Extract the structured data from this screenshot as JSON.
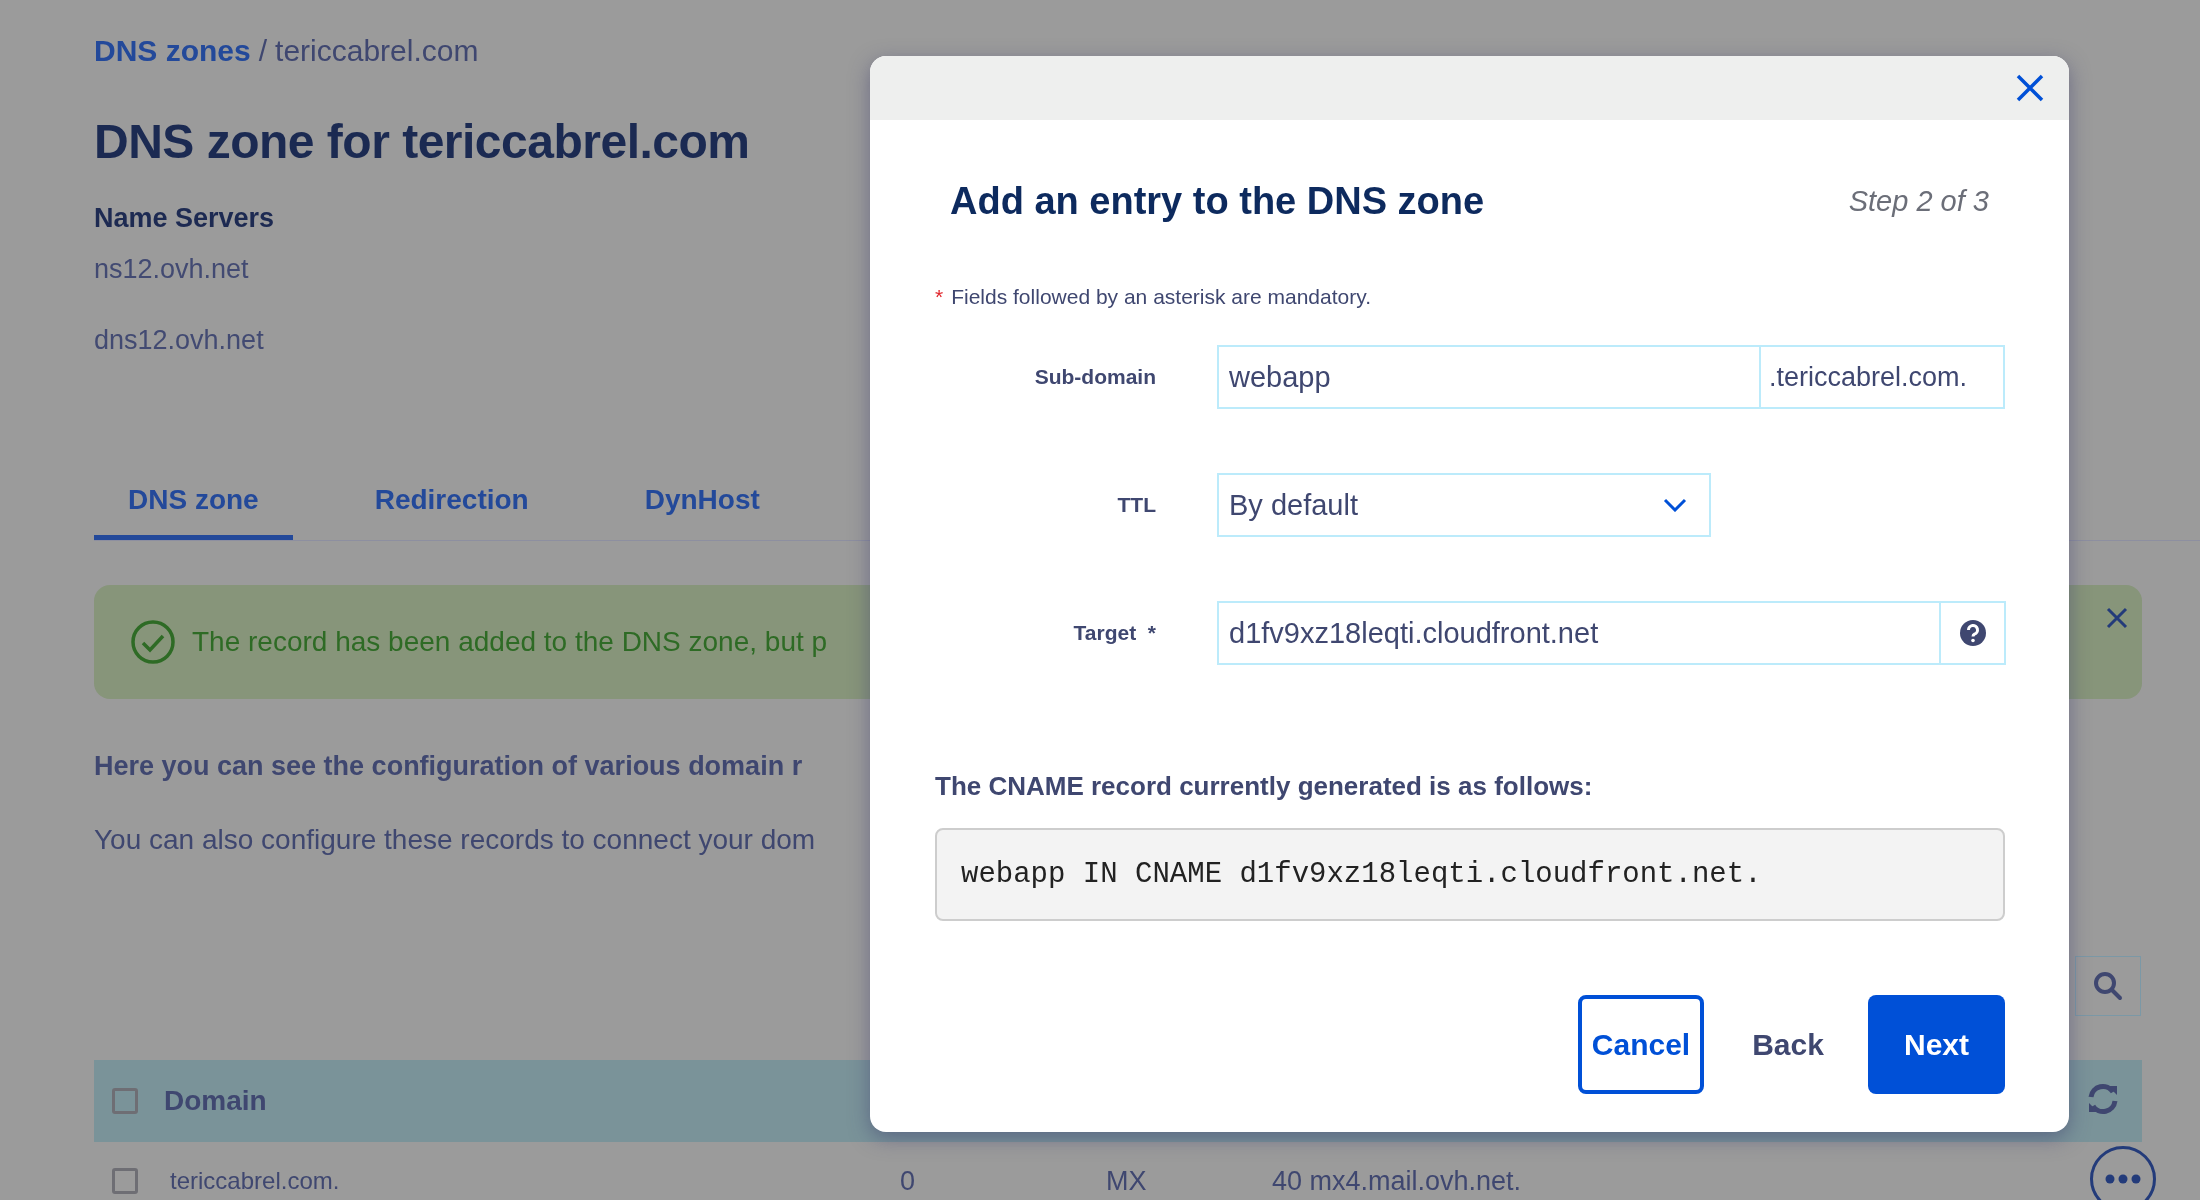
{
  "breadcrumb": {
    "link": "DNS zones",
    "separator": "/",
    "current": "tericcabrel.com"
  },
  "title": "DNS zone for tericcabrel.com",
  "name_servers": {
    "heading": "Name Servers",
    "items": [
      "ns12.ovh.net",
      "dns12.ovh.net"
    ]
  },
  "tabs": [
    {
      "label": "DNS zone",
      "selected": true
    },
    {
      "label": "Redirection",
      "selected": false
    },
    {
      "label": "DynHost",
      "selected": false
    }
  ],
  "alert": {
    "kind": "success",
    "text": "The record has been added to the DNS zone, but p"
  },
  "intro": {
    "heading": "Here you can see the configuration of various domain r",
    "text": "You can also configure these records to connect your dom"
  },
  "table": {
    "header_checked": false,
    "columns": [
      "Domain"
    ],
    "rows": [
      {
        "checked": false,
        "cells": [
          "tericcabrel.com.",
          "0",
          "MX",
          "40 mx4.mail.ovh.net."
        ]
      }
    ]
  },
  "modal": {
    "title": "Add an entry to the DNS zone",
    "step": "Step 2 of 3",
    "note_mark": "*",
    "note": "Fields followed by an asterisk are mandatory.",
    "fields": [
      {
        "kind": "text",
        "label": "Sub-domain",
        "value": "webapp",
        "suffix": ".tericcabrel.com."
      },
      {
        "kind": "select",
        "label": "TTL",
        "value": "By default"
      },
      {
        "kind": "help",
        "label": "Target",
        "required_mark": "*",
        "value": "d1fv9xz18leqti.cloudfront.net"
      }
    ],
    "record_heading": "The CNAME record currently generated is as follows:",
    "record": "webapp IN CNAME d1fv9xz18leqti.cloudfront.net.",
    "buttons": [
      {
        "kind": "outline",
        "label": "Cancel"
      },
      {
        "kind": "plain",
        "label": "Back"
      },
      {
        "kind": "primary",
        "label": "Next"
      }
    ]
  }
}
